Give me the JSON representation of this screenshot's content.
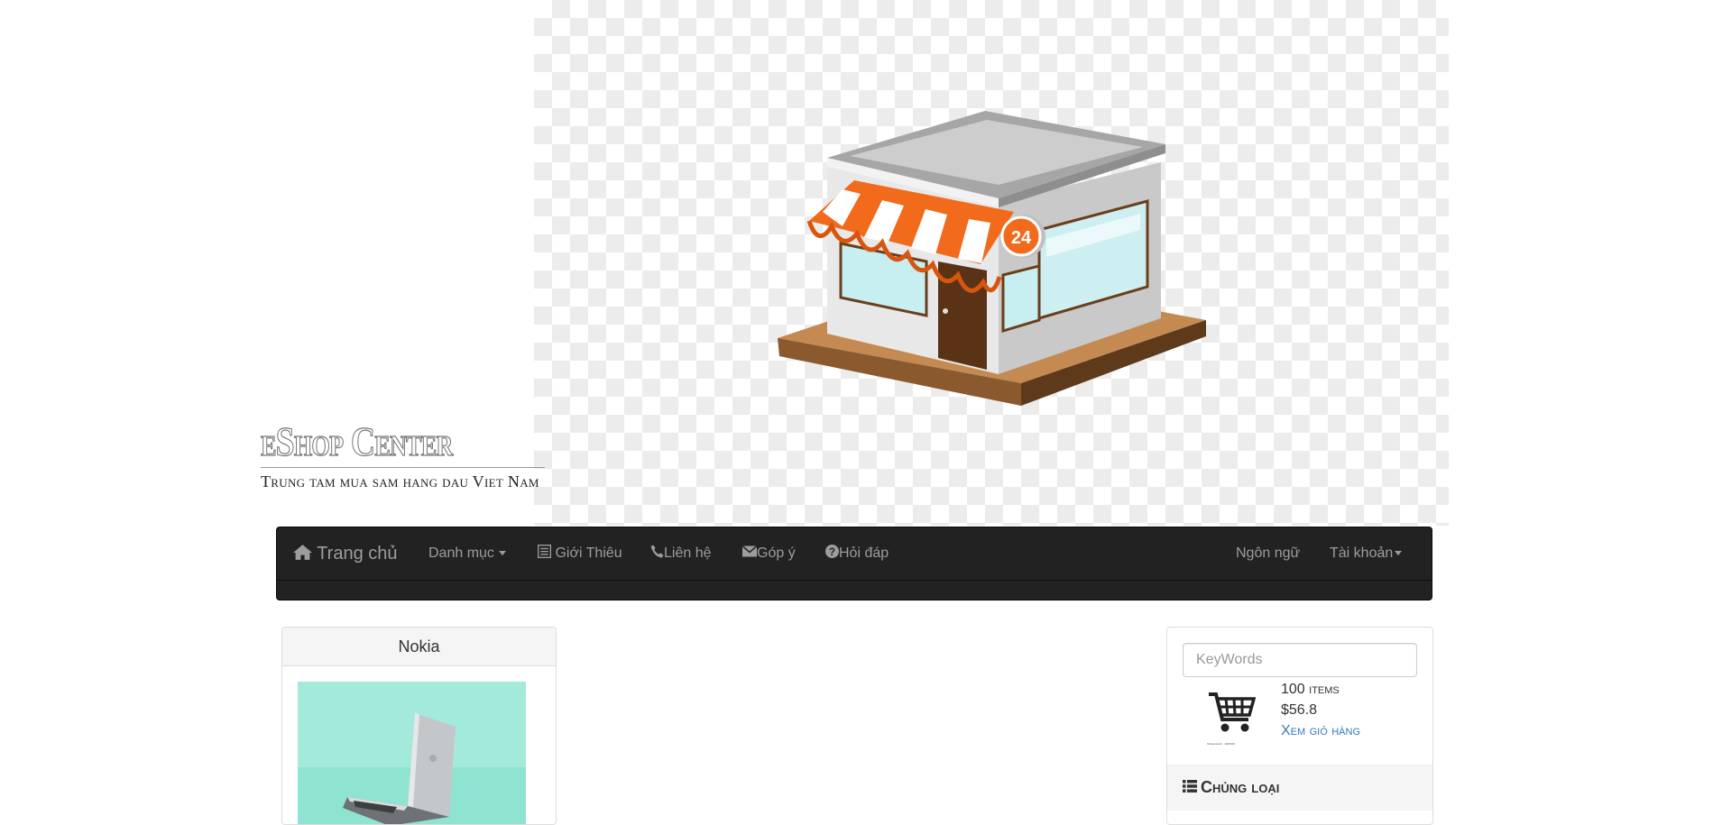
{
  "header": {
    "logo_title": "eShop Center",
    "logo_subtitle": "Trung tam mua sam hang dau Viet Nam",
    "banner_badge": "24"
  },
  "navbar": {
    "brand": "Trang chủ",
    "items": [
      {
        "label": "Danh mục",
        "icon": "caret-down-icon"
      },
      {
        "label": "Giới Thiêu",
        "icon": "list-alt-icon"
      },
      {
        "label": "Liên hệ",
        "icon": "phone-icon"
      },
      {
        "label": "Góp ý",
        "icon": "envelope-icon"
      },
      {
        "label": "Hỏi đáp",
        "icon": "question-circle-icon"
      }
    ],
    "right_items": [
      {
        "label": "Ngôn ngữ"
      },
      {
        "label": "Tài khoản",
        "icon": "caret-down-icon"
      }
    ]
  },
  "product_panel": {
    "title": "Nokia"
  },
  "sidebar": {
    "search_placeholder": "KeyWords",
    "cart": {
      "count_number": "100",
      "count_unit": "items",
      "total": "$56.8",
      "view_link": "Xem giỏ hàng",
      "fine_print": "Shutterstock · 1005015"
    },
    "categories_title": "Chủng loại"
  },
  "colors": {
    "navbar_bg": "#222222",
    "navbar_text": "#9d9d9d",
    "link": "#337ab7",
    "awning_orange": "#f26a1b",
    "product_bg": "#9be8d8"
  }
}
